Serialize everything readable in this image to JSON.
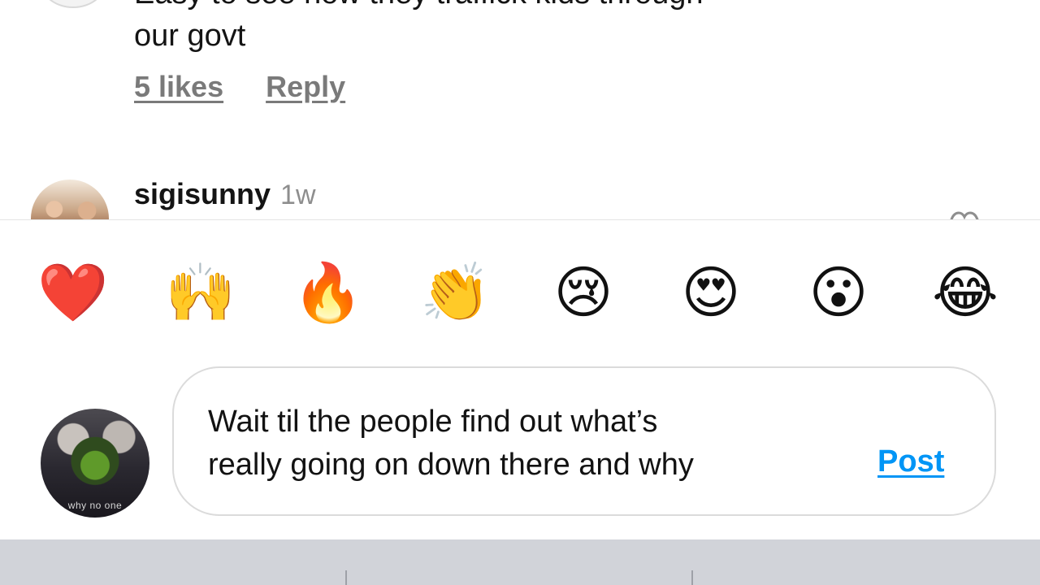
{
  "thread": {
    "previous_comment": {
      "text": "Easy to see how they traffick kids through\nour govt",
      "likes": "5 likes",
      "reply": "Reply"
    },
    "next_comment": {
      "username": "sigisunny",
      "time": "1w"
    }
  },
  "reactions": [
    "❤️",
    "🙌",
    "🔥",
    "👏",
    "😢",
    "😍",
    "😮",
    "😂"
  ],
  "composer": {
    "text": "Wait til the people find out what’s\nreally going on down there and why",
    "post_label": "Post",
    "avatar_watermark": "why no one"
  },
  "colors": {
    "post_blue": "#0095f6",
    "muted_gray": "#7a7a7a",
    "keyboard_bg": "#d1d3d9"
  }
}
